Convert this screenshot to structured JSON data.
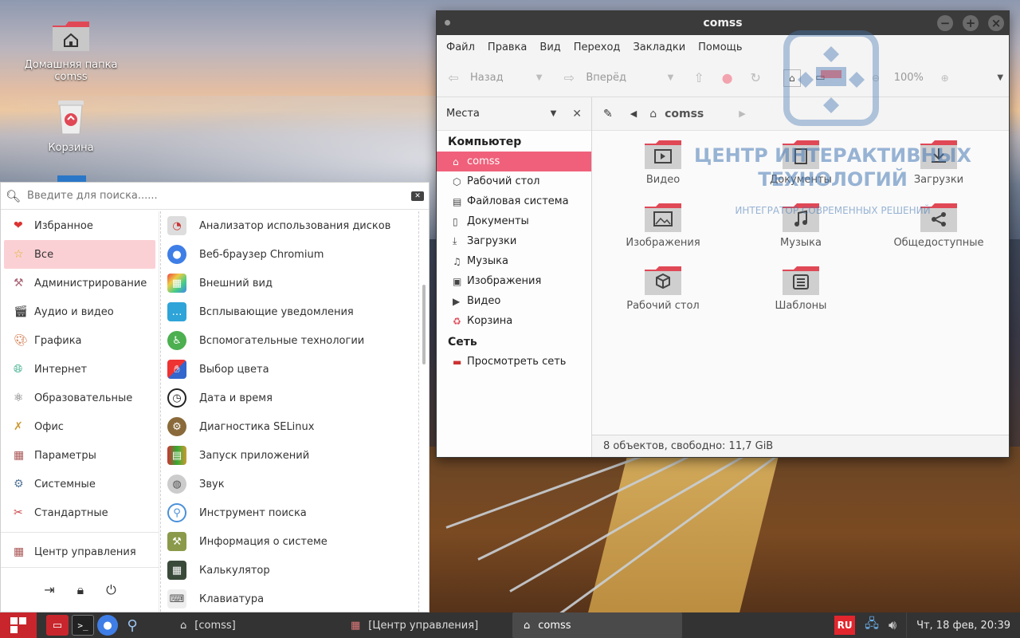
{
  "desktop": {
    "icons": [
      {
        "label": "Домашняя папка\ncomss",
        "line1": "Домашняя папка",
        "line2": "comss"
      },
      {
        "label": "Корзина"
      }
    ]
  },
  "file_manager": {
    "title": "comss",
    "menu": [
      "Файл",
      "Правка",
      "Вид",
      "Переход",
      "Закладки",
      "Помощь"
    ],
    "toolbar": {
      "back": "Назад",
      "forward": "Вперёд",
      "zoom": "100%"
    },
    "sidebar": {
      "header": "Места",
      "sections": [
        {
          "title": "Компьютер",
          "items": [
            "comss",
            "Рабочий стол",
            "Файловая система",
            "Документы",
            "Загрузки",
            "Музыка",
            "Изображения",
            "Видео",
            "Корзина"
          ]
        },
        {
          "title": "Сеть",
          "items": [
            "Просмотреть сеть"
          ]
        }
      ],
      "selected": "comss"
    },
    "path": "comss",
    "folders": [
      "Видео",
      "Документы",
      "Загрузки",
      "Изображения",
      "Музыка",
      "Общедоступные",
      "Рабочий стол",
      "Шаблоны"
    ],
    "status": "8 объектов, свободно: 11,7 GiB"
  },
  "watermark": {
    "line1": "ЦЕНТР ИНТЕРАКТИВНЫХ",
    "line2": "ТЕХНОЛОГИЙ",
    "sub": "ИНТЕГРАТОР СОВРЕМЕННЫХ РЕШЕНИЙ"
  },
  "app_menu": {
    "search_placeholder": "Введите для поиска......",
    "categories": [
      "Избранное",
      "Все",
      "Администрирование",
      "Аудио и видео",
      "Графика",
      "Интернет",
      "Образовательные",
      "Офис",
      "Параметры",
      "Системные",
      "Стандартные"
    ],
    "selected_category": "Все",
    "control_center": "Центр управления",
    "apps": [
      "Анализатор использования дисков",
      "Веб-браузер Chromium",
      "Внешний вид",
      "Всплывающие уведомления",
      "Вспомогательные технологии",
      "Выбор цвета",
      "Дата и время",
      "Диагностика SELinux",
      "Запуск приложений",
      "Звук",
      "Инструмент поиска",
      "Информация о системе",
      "Калькулятор",
      "Клавиатура"
    ]
  },
  "panel": {
    "tasks": [
      "[comss]",
      "[Центр управления]",
      "comss"
    ],
    "lang": "RU",
    "clock": "Чт, 18 фев, 20:39"
  },
  "colors": {
    "accent": "#f0607a",
    "menu_selected": "#fbd0d4",
    "start": "#c8262c",
    "panel": "#333333"
  }
}
